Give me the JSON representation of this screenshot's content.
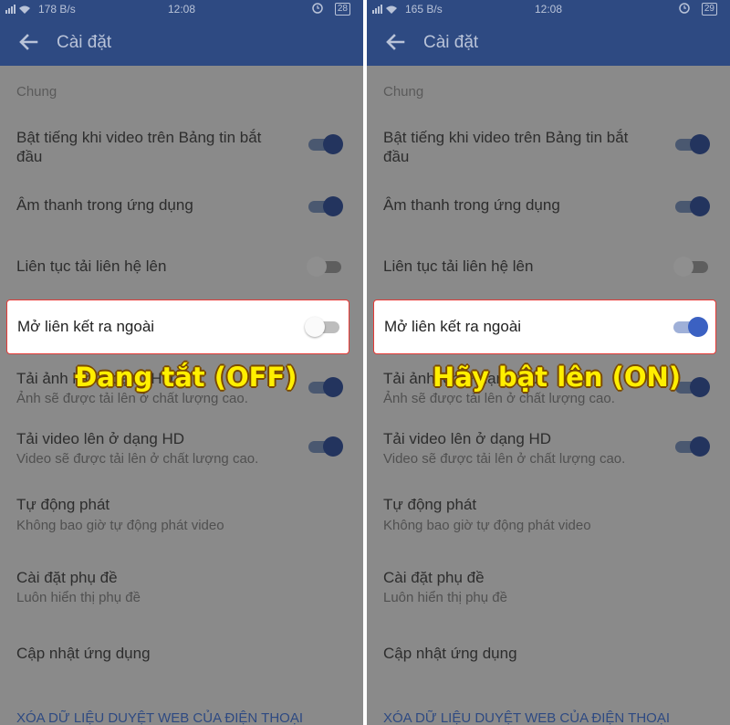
{
  "left": {
    "status": {
      "speed": "178 B/s",
      "time": "12:08",
      "battery": "28"
    },
    "appbar_title": "Cài đặt",
    "section": "Chung",
    "rows": [
      {
        "title": "Bật tiếng khi video trên Bảng tin bắt đầu",
        "subtitle": "",
        "toggle": "on"
      },
      {
        "title": "Âm thanh trong ứng dụng",
        "subtitle": "",
        "toggle": "on"
      },
      {
        "title": "Liên tục tải liên hệ lên",
        "subtitle": "",
        "toggle": "off"
      },
      {
        "title": "Mở liên kết ra ngoài",
        "subtitle": "",
        "toggle": "off"
      },
      {
        "title": "Tải ảnh lên ở dạng HD",
        "subtitle": "Ảnh sẽ được tải lên ở chất lượng cao.",
        "toggle": "on"
      },
      {
        "title": "Tải video lên ở dạng HD",
        "subtitle": "Video sẽ được tải lên ở chất lượng cao.",
        "toggle": "on"
      },
      {
        "title": "Tự động phát",
        "subtitle": "Không bao giờ tự động phát video"
      },
      {
        "title": "Cài đặt phụ đề",
        "subtitle": "Luôn hiển thị phụ đề"
      },
      {
        "title": "Cập nhật ứng dụng",
        "subtitle": ""
      }
    ],
    "link": "XÓA DỮ LIỆU DUYỆT WEB CỦA ĐIỆN THOẠI",
    "overlay": "Đang tắt (OFF)"
  },
  "right": {
    "status": {
      "speed": "165 B/s",
      "time": "12:08",
      "battery": "29"
    },
    "appbar_title": "Cài đặt",
    "section": "Chung",
    "rows": [
      {
        "title": "Bật tiếng khi video trên Bảng tin bắt đầu",
        "subtitle": "",
        "toggle": "on"
      },
      {
        "title": "Âm thanh trong ứng dụng",
        "subtitle": "",
        "toggle": "on"
      },
      {
        "title": "Liên tục tải liên hệ lên",
        "subtitle": "",
        "toggle": "off"
      },
      {
        "title": "Mở liên kết ra ngoài",
        "subtitle": "",
        "toggle": "on"
      },
      {
        "title": "Tải ảnh lên ở dạng HD",
        "subtitle": "Ảnh sẽ được tải lên ở chất lượng cao.",
        "toggle": "on"
      },
      {
        "title": "Tải video lên ở dạng HD",
        "subtitle": "Video sẽ được tải lên ở chất lượng cao.",
        "toggle": "on"
      },
      {
        "title": "Tự động phát",
        "subtitle": "Không bao giờ tự động phát video"
      },
      {
        "title": "Cài đặt phụ đề",
        "subtitle": "Luôn hiển thị phụ đề"
      },
      {
        "title": "Cập nhật ứng dụng",
        "subtitle": ""
      }
    ],
    "link": "XÓA DỮ LIỆU DUYỆT WEB CỦA ĐIỆN THOẠI",
    "overlay": "Hãy bật lên (ON)"
  },
  "icons": {
    "back": "arrow-left-icon",
    "signal": "signal-icon",
    "wifi": "wifi-icon",
    "alarm": "alarm-icon",
    "battery": "battery-icon"
  },
  "colors": {
    "appbar": "#2e4a82",
    "highlight_border": "#e53935",
    "toggle_on": "#3b61c2",
    "overlay_text": "#ffef00"
  }
}
